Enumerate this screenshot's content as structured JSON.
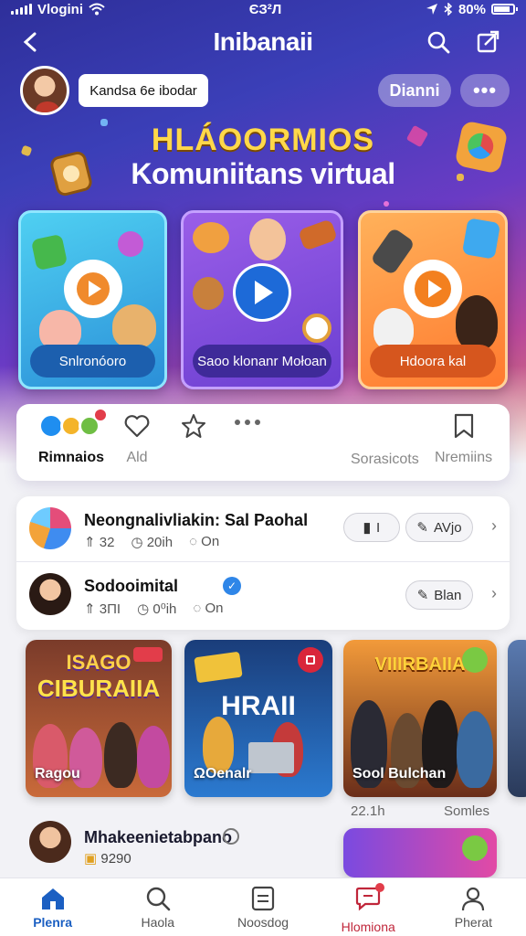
{
  "status_bar": {
    "carrier": "Vlogini",
    "time": "ЄЗ²Л",
    "battery": "80%"
  },
  "header": {
    "title": "Inibanaii"
  },
  "profile": {
    "name": "Kandsa 6e ibodar",
    "action_label": "Dianni",
    "more_label": "•••"
  },
  "hero": {
    "headline": "HLÁOORMIOS",
    "subheadline": "Komuniitans virtual"
  },
  "feature_cards": [
    {
      "caption": "Snlronóoro"
    },
    {
      "caption": "Saoo klonanr Mołoan"
    },
    {
      "caption": "Hdoora kal"
    }
  ],
  "actions": {
    "reactions_label": "Rimnaios",
    "add_label": "Ald",
    "extra_label": "Sorasicots",
    "save_label": "Nremiins"
  },
  "posts": [
    {
      "title": "Neongnalivliakin: Sal Paohal",
      "likes": "32",
      "time": "20ih",
      "views": "On",
      "chip1": "I",
      "chip2": "AVjo"
    },
    {
      "title": "Sodooimital",
      "likes": "3ΠI",
      "time": "0⁰ih",
      "views": "On",
      "chip2": "Blan"
    }
  ],
  "videos": [
    {
      "poster": "CIBURAIIA",
      "poster_top": "ISAGO",
      "title": "Ragou",
      "badge_color": "#e23d4a"
    },
    {
      "poster": "HRAII",
      "title": "ΩOenalr",
      "badge_color": "#d9263a"
    },
    {
      "poster": "VIIIRBAIIA",
      "title": "Sool Bulchan",
      "badge_color": "#7ac943"
    }
  ],
  "video_meta": {
    "left": "22.1h",
    "right": "Somles"
  },
  "bottom_user": {
    "name": "Mhakeenietabpano",
    "meta": "9290"
  },
  "tabs": [
    {
      "label": "Plenra",
      "icon": "home-icon"
    },
    {
      "label": "Haola",
      "icon": "search-icon"
    },
    {
      "label": "Noosdog",
      "icon": "document-icon"
    },
    {
      "label": "Hlomiona",
      "icon": "chat-icon"
    },
    {
      "label": "Pherat",
      "icon": "profile-icon"
    }
  ],
  "colors": {
    "accent": "#1b63d6",
    "active_tab": "#1b5fc2",
    "notification": "#e23d4a"
  }
}
